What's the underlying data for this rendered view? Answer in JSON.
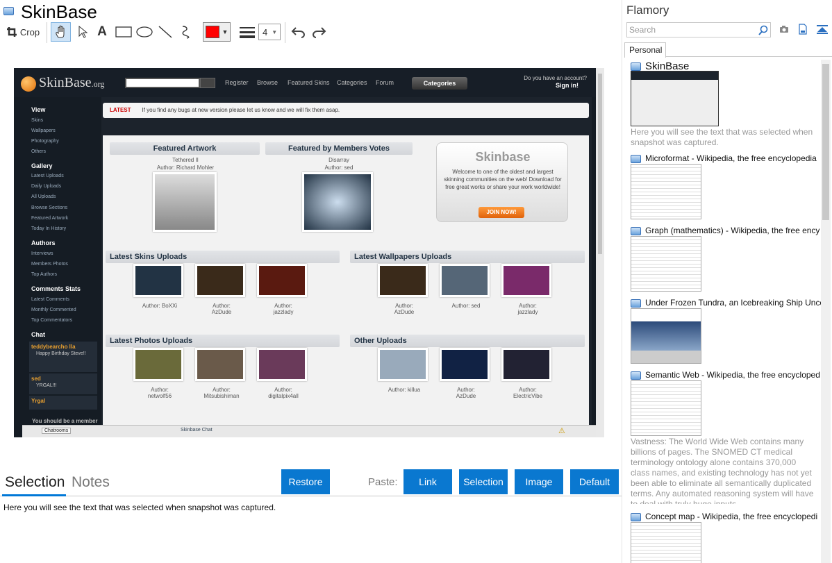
{
  "window": {
    "title": "SkinBase"
  },
  "toolbar": {
    "crop_label": "Crop",
    "tools": [
      "hand-icon",
      "pointer-icon",
      "text-icon",
      "rectangle-icon",
      "ellipse-icon",
      "line-icon",
      "freehand-icon"
    ],
    "color": "#ff0000",
    "line_width": "4"
  },
  "screenshot": {
    "logo": "SkinBase",
    "logo_suffix": ".org",
    "nav": [
      "Register",
      "Browse",
      "Featured Skins",
      "Categories",
      "Forum"
    ],
    "categories_button": "Categories",
    "account_question": "Do you have an account?",
    "sign_in": "Sign in!",
    "sidebar": [
      {
        "heading": "View",
        "items": [
          "Skins",
          "Wallpapers",
          "Photography",
          "Others"
        ]
      },
      {
        "heading": "Gallery",
        "items": [
          "Latest Uploads",
          "Daily Uploads",
          "All Uploads",
          "Browse Sections",
          "Featured Artwork",
          "Today In History"
        ]
      },
      {
        "heading": "Authors",
        "items": [
          "Interviews",
          "Members Photos",
          "Top Authors"
        ]
      },
      {
        "heading": "Comments Stats",
        "items": [
          "Latest Comments",
          "Monthly Commented",
          "Top Commentators"
        ]
      },
      {
        "heading": "Chat",
        "items": []
      }
    ],
    "chat": [
      {
        "user": "teddybearcho lla",
        "msg": "Happy Birthday Steve!!"
      },
      {
        "user": "sed",
        "msg": "YRGAL!!!"
      },
      {
        "user": "Yrgal",
        "msg": ""
      }
    ],
    "member_text": "You should be a member",
    "latest_label": "LATEST",
    "latest_text": "If you find any bugs at new version please let us know and we will fix them asap.",
    "featured_artwork": {
      "title": "Featured Artwork",
      "name": "Tethered II",
      "author": "Author: Richard Mohler"
    },
    "featured_votes": {
      "title": "Featured by Members Votes",
      "name": "Disarray",
      "author": "Author: sed"
    },
    "promo": {
      "title": "Skinbase",
      "text": "Welcome to one of the oldest and largest skinning communities on the web! Download for free great works or share your work worldwide!",
      "button": "JOIN NOW!"
    },
    "sections": {
      "skins": {
        "title": "Latest Skins Uploads",
        "items": [
          {
            "author": "Author: BoXXi",
            "color": "#223344"
          },
          {
            "author": "Author:\nAzDude",
            "color": "#3a2a1a"
          },
          {
            "author": "Author:\njazzlady",
            "color": "#5a1a10"
          }
        ]
      },
      "wallpapers": {
        "title": "Latest Wallpapers Uploads",
        "items": [
          {
            "author": "Author:\nAzDude",
            "color": "#3a2a1a"
          },
          {
            "author": "Author: sed",
            "color": "#556677"
          },
          {
            "author": "Author:\njazzlady",
            "color": "#7a2a6a"
          }
        ]
      },
      "photos": {
        "title": "Latest Photos Uploads",
        "items": [
          {
            "author": "Author:\nnetwolf56",
            "color": "#6a6a3a"
          },
          {
            "author": "Author:\nMitsubishiman",
            "color": "#6a5a4a"
          },
          {
            "author": "Author:\ndigitalpix4all",
            "color": "#6a3a5a"
          }
        ]
      },
      "other": {
        "title": "Other Uploads",
        "items": [
          {
            "author": "Author: killua",
            "color": "#9ab"
          },
          {
            "author": "Author:\nAzDude",
            "color": "#112244"
          },
          {
            "author": "Author:\nElectricVibe",
            "color": "#223"
          }
        ]
      }
    },
    "taskbar": {
      "chatrooms": "Chatrooms",
      "chat": "Skinbase Chat"
    }
  },
  "bottom": {
    "tab_selection": "Selection",
    "tab_notes": "Notes",
    "restore": "Restore",
    "paste_label": "Paste:",
    "paste_buttons": [
      "Link",
      "Selection",
      "Image",
      "Default"
    ],
    "selection_text": "Here you will see the text that was selected when snapshot was captured."
  },
  "panel": {
    "title": "Flamory",
    "search_placeholder": "Search",
    "tab": "Personal",
    "items": [
      {
        "title": "SkinBase",
        "desc": "Here you will see the text that was selected when snapshot was captured."
      },
      {
        "title": "Microformat - Wikipedia, the free encyclopedia",
        "desc": ""
      },
      {
        "title": "Graph (mathematics) - Wikipedia, the free ency",
        "desc": ""
      },
      {
        "title": "Under Frozen Tundra, an Icebreaking Ship Unco",
        "desc": ""
      },
      {
        "title": "Semantic Web - Wikipedia, the free encycloped",
        "desc": "Vastness: The World Wide Web contains many billions of pages. The SNOMED CT medical terminology ontology alone contains 370,000 class names, and existing technology has not yet been able to eliminate all semantically duplicated terms. Any automated reasoning system will have to deal with truly huge inputs."
      },
      {
        "title": "Concept map - Wikipedia, the free encyclopedi",
        "desc": ""
      }
    ]
  }
}
